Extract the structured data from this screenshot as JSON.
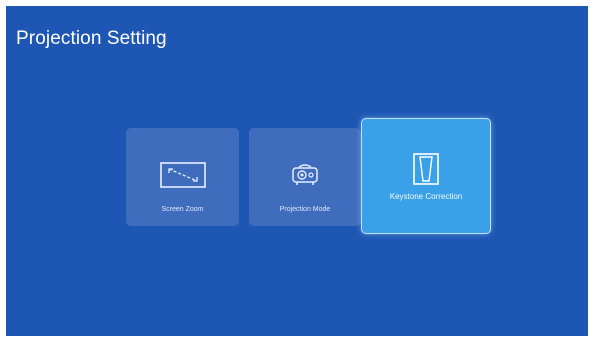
{
  "page": {
    "title": "Projection Setting"
  },
  "menu": {
    "selected_index": 2,
    "items": [
      {
        "label": "Screen Zoom",
        "icon": "screen-zoom-icon"
      },
      {
        "label": "Projection Mode",
        "icon": "projector-icon"
      },
      {
        "label": "Keystone Correction",
        "icon": "keystone-icon"
      }
    ]
  },
  "colors": {
    "background": "#1e57b3",
    "tile": "#3f6cbc",
    "tile_selected": "#3aa1e8"
  }
}
